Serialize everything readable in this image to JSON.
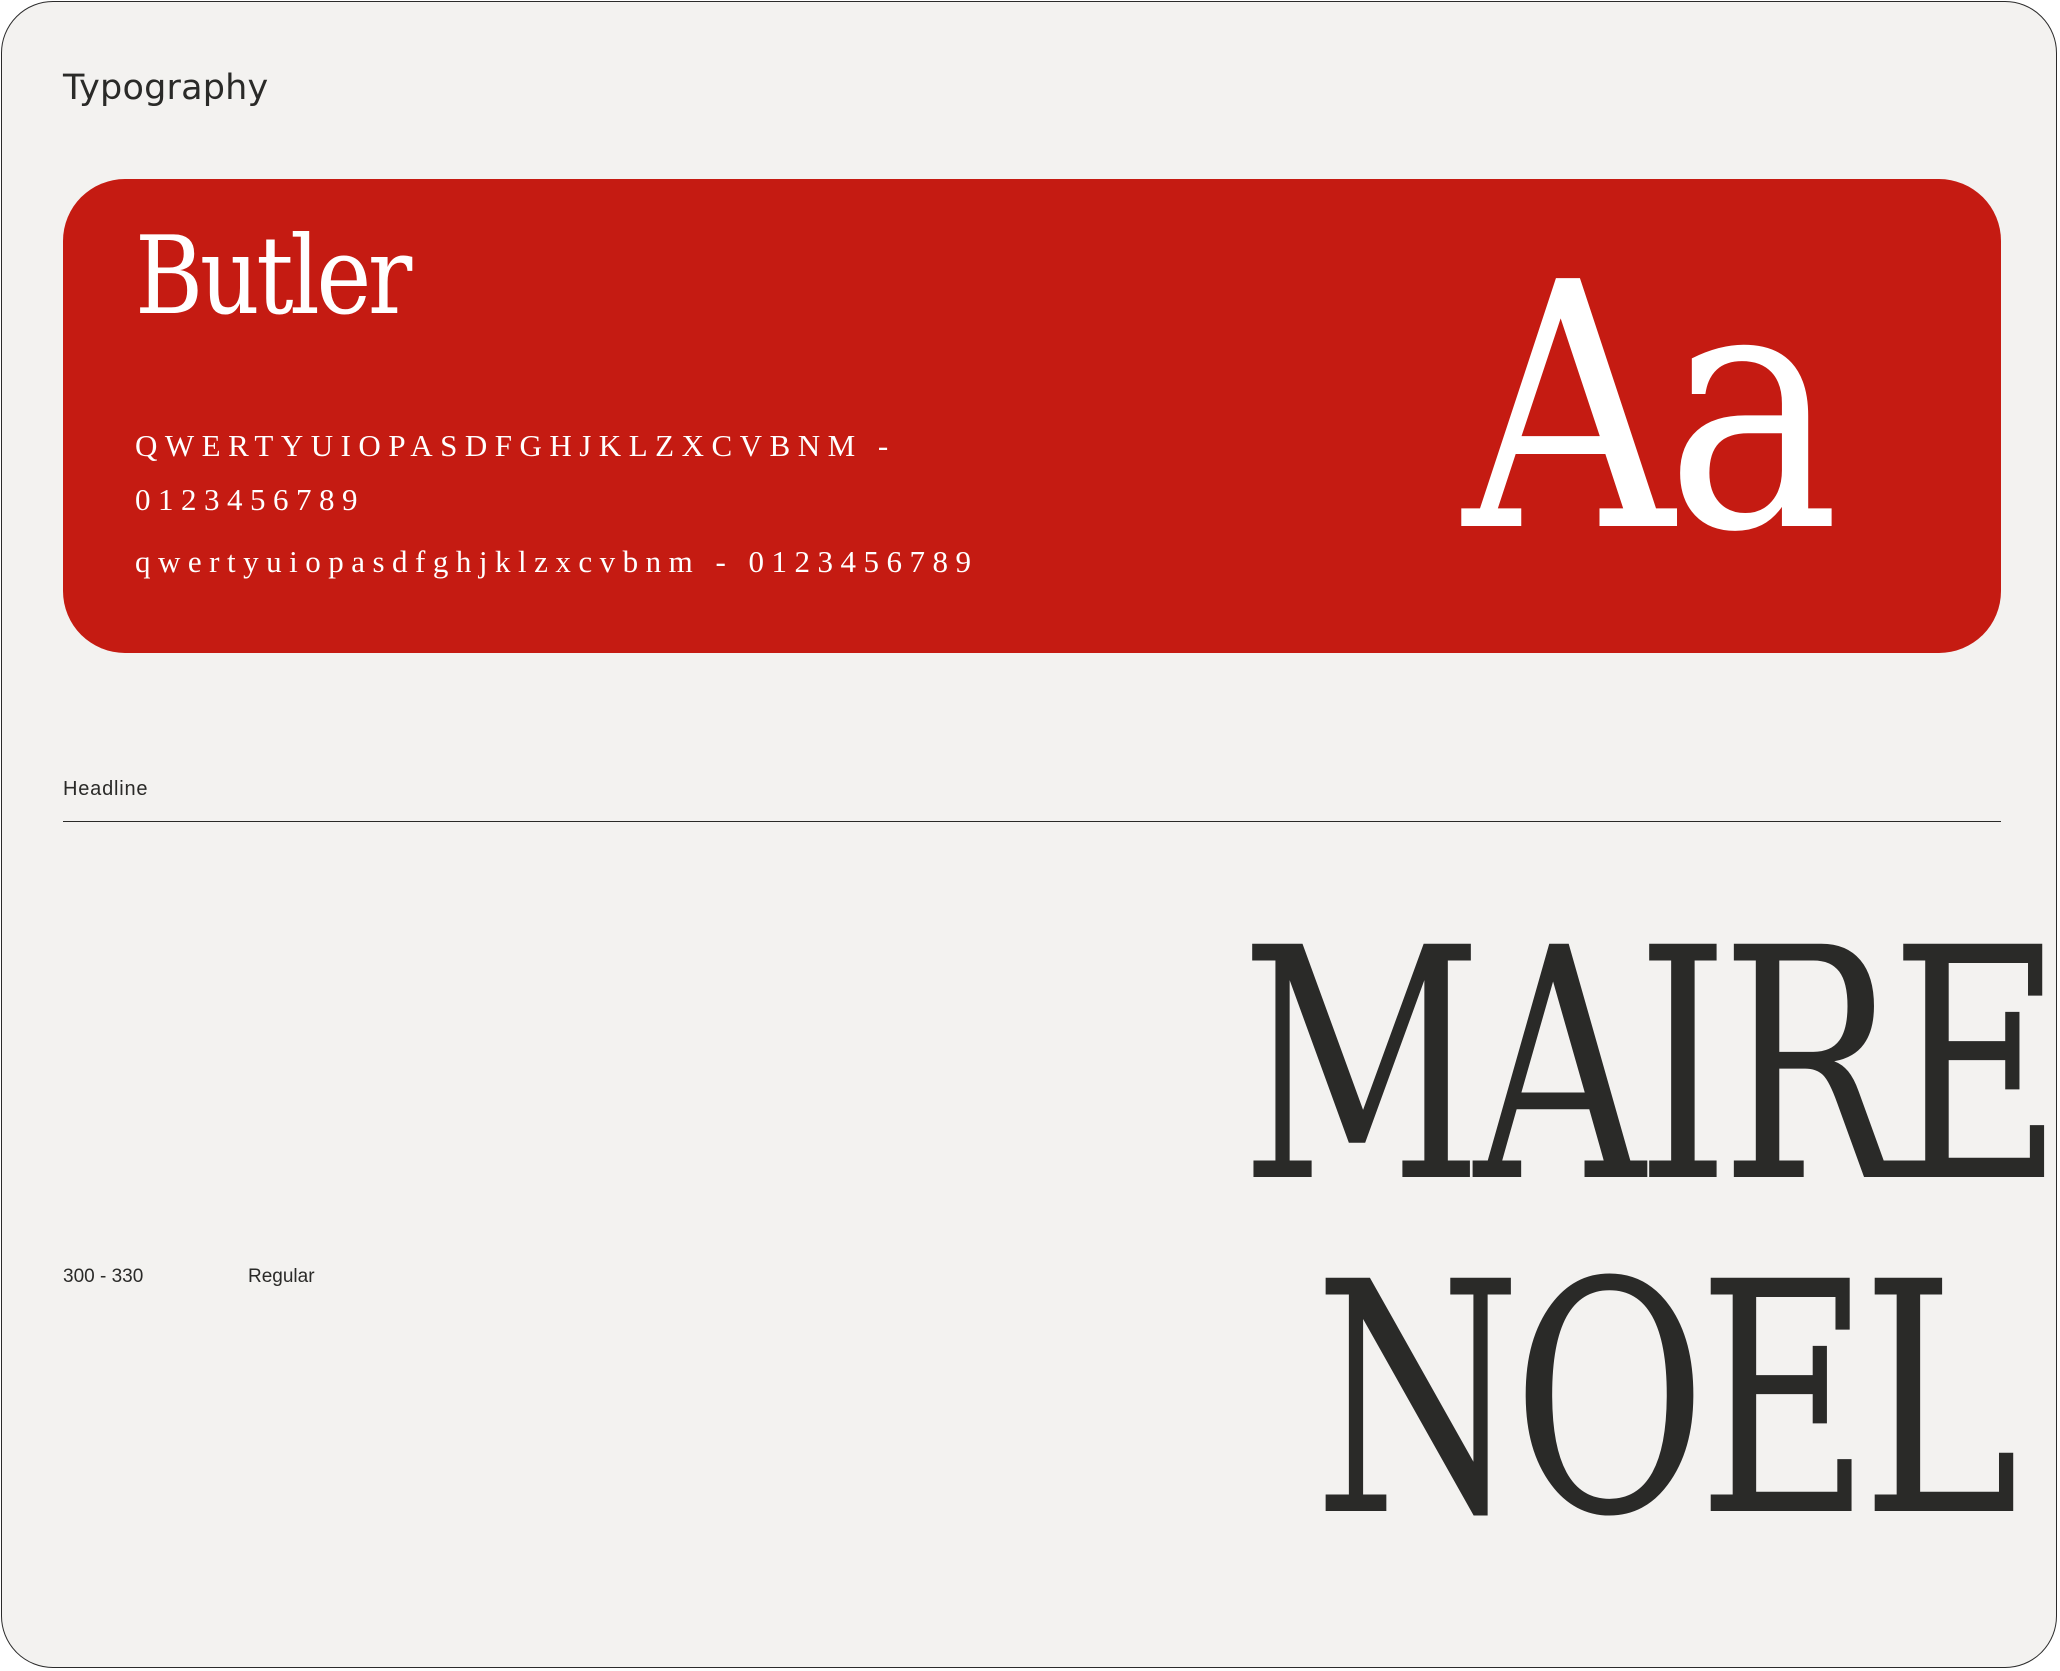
{
  "page": {
    "section_title": "Typography"
  },
  "font_card": {
    "font_name": "Butler",
    "uppercase_glyphs": "QWERTYUIOPASDFGHJKLZXCVBNM - 0123456789",
    "lowercase_glyphs": "qwertyuiopasdfghjklzxcvbnm - 0123456789",
    "specimen": "Aa",
    "background_color": "#c51b12",
    "text_color": "#ffffff"
  },
  "headline": {
    "label": "Headline",
    "size_range": "300 - 330",
    "weight": "Regular",
    "sample_line_1": "MAIRE",
    "sample_line_2": "NOEL",
    "text_color": "#2a2a28"
  }
}
